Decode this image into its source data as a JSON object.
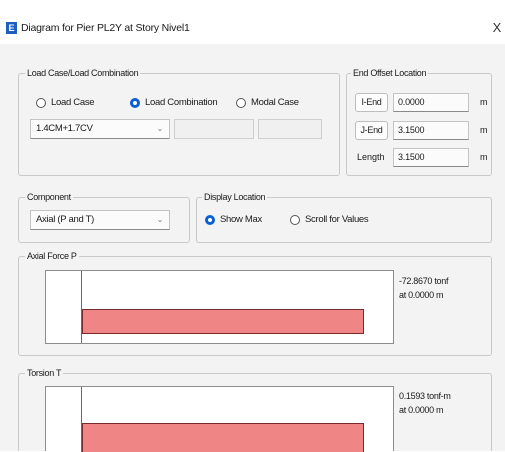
{
  "window": {
    "app_icon_letter": "E",
    "title": "Diagram for Pier PL2Y at Story Nivel1",
    "close_glyph": "X"
  },
  "load_case": {
    "legend": "Load Case/Load Combination",
    "options": [
      {
        "label": "Load Case",
        "selected": false
      },
      {
        "label": "Load Combination",
        "selected": true
      },
      {
        "label": "Modal Case",
        "selected": false
      }
    ],
    "combo_value": "1.4CM+1.7CV"
  },
  "end_offset": {
    "legend": "End Offset Location",
    "rows": [
      {
        "button": "I-End",
        "value": "0.0000",
        "unit": "m"
      },
      {
        "button": "J-End",
        "value": "3.1500",
        "unit": "m"
      },
      {
        "label": "Length",
        "value": "3.1500",
        "unit": "m"
      }
    ]
  },
  "component": {
    "legend": "Component",
    "value": "Axial (P and T)"
  },
  "display_location": {
    "legend": "Display Location",
    "options": [
      {
        "label": "Show Max",
        "selected": true
      },
      {
        "label": "Scroll for Values",
        "selected": false
      }
    ]
  },
  "axial": {
    "legend": "Axial Force P",
    "value_text": "-72.8670 tonf",
    "location_text": "at 0.0000 m",
    "value": -72.867
  },
  "torsion": {
    "legend": "Torsion T",
    "value_text": "0.1593 tonf-m",
    "location_text": "at 0.0000 m",
    "value": 0.1593
  },
  "colors": {
    "accent": "#0a5fd6",
    "bar_fill": "#f08585",
    "baseline": "#3f8a3a"
  }
}
